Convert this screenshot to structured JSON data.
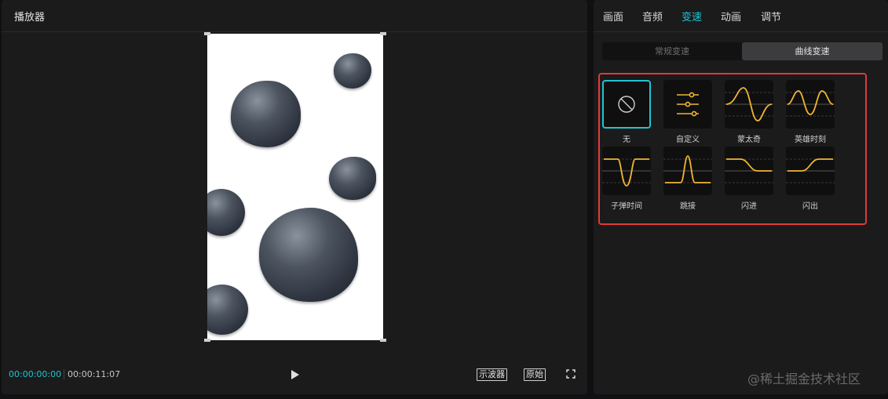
{
  "player": {
    "title": "播放器",
    "time_current": "00:00:00:00",
    "time_total": "00:00:11:07",
    "waveform_label": "示波器",
    "original_label": "原始"
  },
  "tabs": [
    "画面",
    "音频",
    "变速",
    "动画",
    "调节"
  ],
  "active_tab": "变速",
  "speed_modes": {
    "normal": "常规变速",
    "curve": "曲线变速"
  },
  "active_mode": "曲线变速",
  "presets": [
    {
      "label": "无",
      "icon": "none-icon",
      "selected": true
    },
    {
      "label": "自定义",
      "icon": "sliders-icon",
      "selected": false
    },
    {
      "label": "蒙太奇",
      "icon": "montage-curve-icon",
      "selected": false
    },
    {
      "label": "英雄时刻",
      "icon": "hero-moment-curve-icon",
      "selected": false
    },
    {
      "label": "子弹时间",
      "icon": "bullet-time-curve-icon",
      "selected": false
    },
    {
      "label": "跳接",
      "icon": "jump-cut-curve-icon",
      "selected": false
    },
    {
      "label": "闪进",
      "icon": "flash-in-curve-icon",
      "selected": false
    },
    {
      "label": "闪出",
      "icon": "flash-out-curve-icon",
      "selected": false
    }
  ],
  "colors": {
    "accent": "#22c3cf",
    "curve": "#f2b531",
    "highlight": "#e03a3a"
  },
  "watermark": "@稀土掘金技术社区"
}
